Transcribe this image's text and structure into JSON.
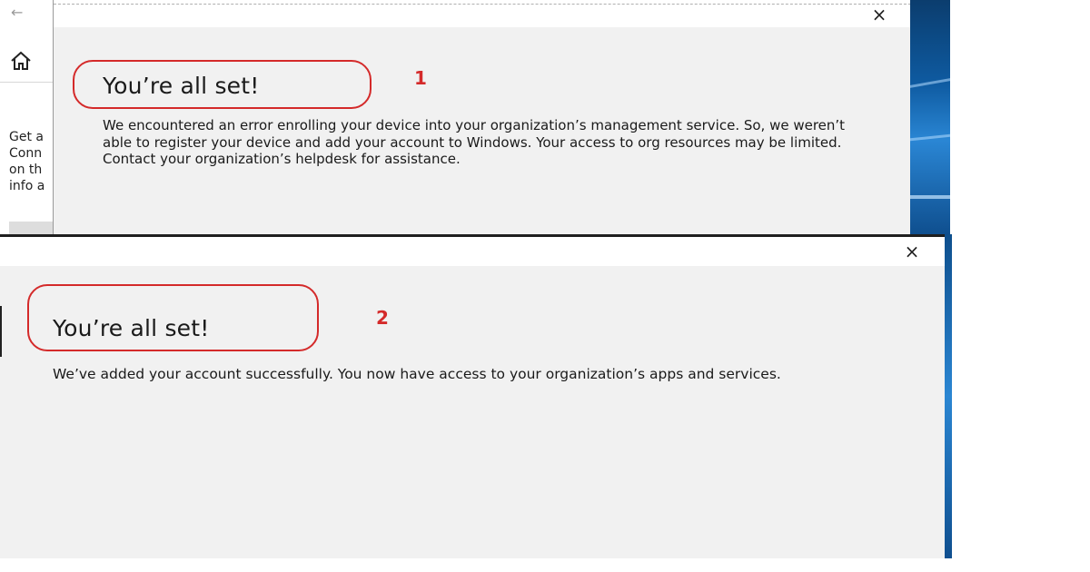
{
  "screenshot_1": {
    "background_window": {
      "back_arrow": "←",
      "text_lines": [
        "Get a",
        "Conn",
        "on th",
        "info a"
      ]
    },
    "dialog": {
      "close_label": "×",
      "heading": "You’re all set!",
      "message": "We encountered an error enrolling your device into your organization’s management service. So, we weren’t able to register your device and add your account to Windows. Your access to org resources may be limited. Contact your organization’s helpdesk for assistance."
    },
    "marker": "1"
  },
  "screenshot_2": {
    "dialog": {
      "close_label": "×",
      "heading": "You’re all set!",
      "message": "We’ve added your account successfully. You now have access to your organization’s apps and services."
    },
    "marker": "2"
  },
  "colors": {
    "annotation_red": "#d42a2a",
    "dialog_background": "#f1f1f1",
    "desktop_blue": "#0e5aa0"
  },
  "icons": {
    "back": "back-arrow-icon",
    "home": "home-icon",
    "close": "close-icon"
  }
}
